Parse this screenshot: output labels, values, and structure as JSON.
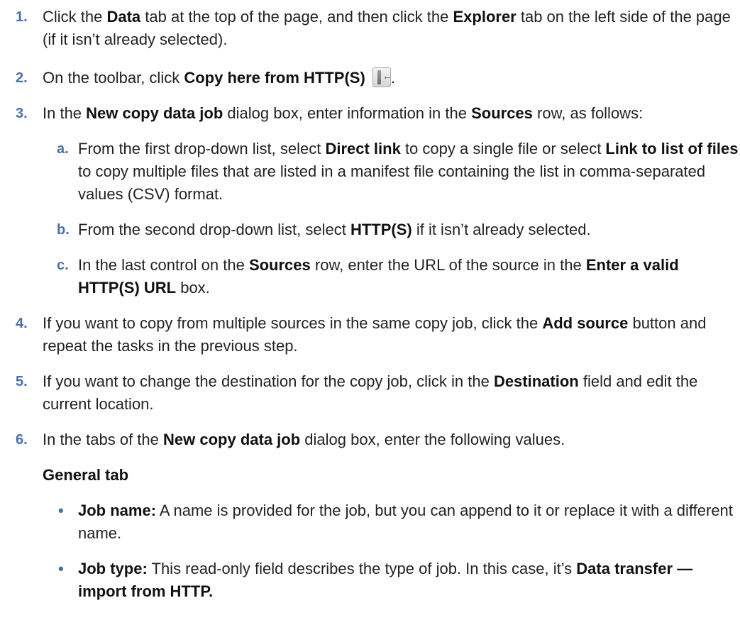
{
  "steps": [
    {
      "num": "1.",
      "parts": [
        "Click the ",
        "Data",
        " tab at the top of the page, and then click the ",
        "Explorer",
        " tab on the left side of the page (if it isn’t already selected)."
      ]
    },
    {
      "num": "2.",
      "parts": [
        "On the toolbar, click ",
        "Copy here from HTTP(S)",
        "."
      ]
    },
    {
      "num": "3.",
      "parts": [
        "In the ",
        "New copy data job",
        " dialog box, enter information in the ",
        "Sources",
        " row, as follows:"
      ]
    },
    {
      "num": "4.",
      "parts": [
        "If you want to copy from multiple sources in the same copy job, click the ",
        "Add source",
        " button and repeat the tasks in the previous step."
      ]
    },
    {
      "num": "5.",
      "parts": [
        "If you want to change the destination for the copy job, click in the ",
        "Destination",
        " field and edit the current location."
      ]
    },
    {
      "num": "6.",
      "parts": [
        "In the tabs of the ",
        "New copy data job",
        " dialog box, enter the following values."
      ]
    }
  ],
  "substeps": [
    {
      "letter": "a.",
      "parts": [
        "From the first drop-down list, select ",
        "Direct link",
        " to copy a single file or select ",
        "Link to list of files",
        " to copy multiple files that are listed in a manifest file containing the list in comma-separated values (CSV) format."
      ]
    },
    {
      "letter": "b.",
      "parts": [
        "From the second drop-down list, select ",
        "HTTP(S)",
        " if it isn’t already selected."
      ]
    },
    {
      "letter": "c.",
      "parts": [
        "In the last control on the ",
        "Sources",
        " row, enter the URL of the source in the ",
        "Enter a valid HTTP(S) URL",
        " box."
      ]
    }
  ],
  "general_heading": "General tab",
  "bullets": [
    {
      "mark": "•",
      "parts": [
        "Job name:",
        " A name is provided for the job, but you can append to it or replace it with a different name."
      ]
    },
    {
      "mark": "•",
      "parts": [
        "Job type:",
        " This read-only field describes the type of job. In this case, it’s ",
        "Data transfer — import from HTTP."
      ]
    }
  ],
  "icons": {
    "copy_http": "copy-here-from-http-icon"
  }
}
